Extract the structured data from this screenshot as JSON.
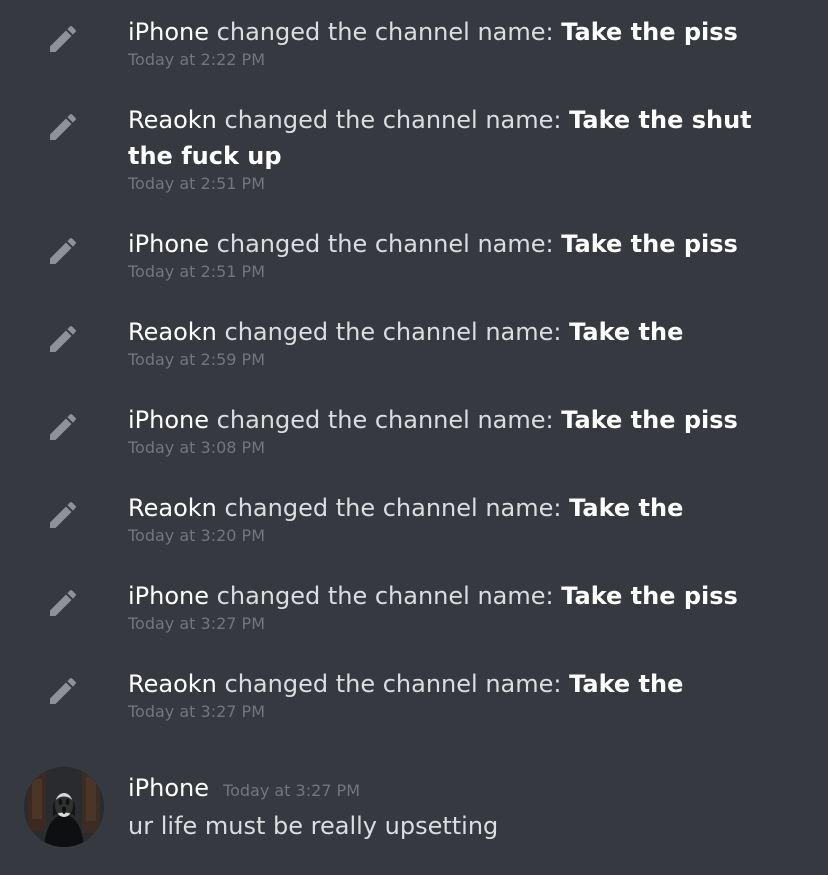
{
  "colors": {
    "background": "#36393f",
    "text": "#dcddde",
    "username": "#ffffff",
    "timestamp": "#72767d",
    "icon": "#8e9297"
  },
  "system_messages": [
    {
      "user": "iPhone",
      "action": "changed the channel name:",
      "channel": "Take the piss",
      "timestamp": "Today at 2:22 PM",
      "icon": "pencil-icon"
    },
    {
      "user": "Reaokn",
      "action": "changed the channel name:",
      "channel": "Take the shut the fuck up",
      "timestamp": "Today at 2:51 PM",
      "icon": "pencil-icon"
    },
    {
      "user": "iPhone",
      "action": "changed the channel name:",
      "channel": "Take the piss",
      "timestamp": "Today at 2:51 PM",
      "icon": "pencil-icon"
    },
    {
      "user": "Reaokn",
      "action": "changed the channel name:",
      "channel": "Take the",
      "timestamp": "Today at 2:59 PM",
      "icon": "pencil-icon"
    },
    {
      "user": "iPhone",
      "action": "changed the channel name:",
      "channel": "Take the piss",
      "timestamp": "Today at 3:08 PM",
      "icon": "pencil-icon"
    },
    {
      "user": "Reaokn",
      "action": "changed the channel name:",
      "channel": "Take the",
      "timestamp": "Today at 3:20 PM",
      "icon": "pencil-icon"
    },
    {
      "user": "iPhone",
      "action": "changed the channel name:",
      "channel": "Take the piss",
      "timestamp": "Today at 3:27 PM",
      "icon": "pencil-icon"
    },
    {
      "user": "Reaokn",
      "action": "changed the channel name:",
      "channel": "Take the",
      "timestamp": "Today at 3:27 PM",
      "icon": "pencil-icon"
    }
  ],
  "chat_message": {
    "author": "iPhone",
    "timestamp": "Today at 3:27 PM",
    "text": "ur life must be really upsetting"
  }
}
